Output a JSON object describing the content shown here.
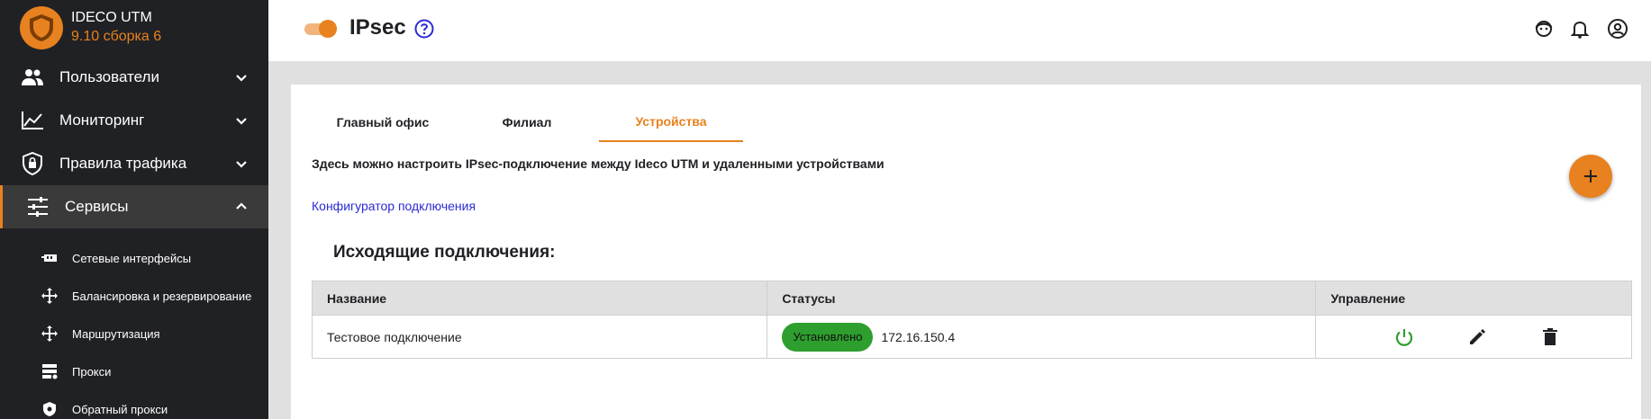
{
  "brand": {
    "name": "IDECO UTM",
    "version": "9.10 сборка 6"
  },
  "colors": {
    "accent": "#e8811f",
    "sidebar_bg": "#202124",
    "status_ok": "#2e9e2e",
    "link": "#2b2bd6"
  },
  "sidebar": {
    "items": [
      {
        "label": "Пользователи",
        "icon": "users-icon"
      },
      {
        "label": "Мониторинг",
        "icon": "chart-line-icon"
      },
      {
        "label": "Правила трафика",
        "icon": "shield-lock-icon"
      },
      {
        "label": "Сервисы",
        "icon": "sliders-icon",
        "active": true
      }
    ],
    "subitems": [
      {
        "label": "Сетевые интерфейсы",
        "icon": "network-card-icon"
      },
      {
        "label": "Балансировка и резервирование",
        "icon": "arrows-split-icon"
      },
      {
        "label": "Маршрутизация",
        "icon": "arrows-all-icon"
      },
      {
        "label": "Прокси",
        "icon": "server-icon"
      },
      {
        "label": "Обратный прокси",
        "icon": "shield-icon"
      }
    ]
  },
  "header": {
    "title": "IPsec",
    "toggle_on": true
  },
  "tabs": [
    {
      "label": "Главный офис"
    },
    {
      "label": "Филиал"
    },
    {
      "label": "Устройства",
      "active": true
    }
  ],
  "content": {
    "description": "Здесь можно настроить IPsec-подключение между Ideco UTM и удаленными устройствами",
    "link": "Конфигуратор подключения",
    "section_title": "Исходящие подключения:"
  },
  "table": {
    "headers": [
      "Название",
      "Статусы",
      "Управление"
    ],
    "rows": [
      {
        "name": "Тестовое подключение",
        "status": "Установлено",
        "ip": "172.16.150.4"
      }
    ]
  }
}
